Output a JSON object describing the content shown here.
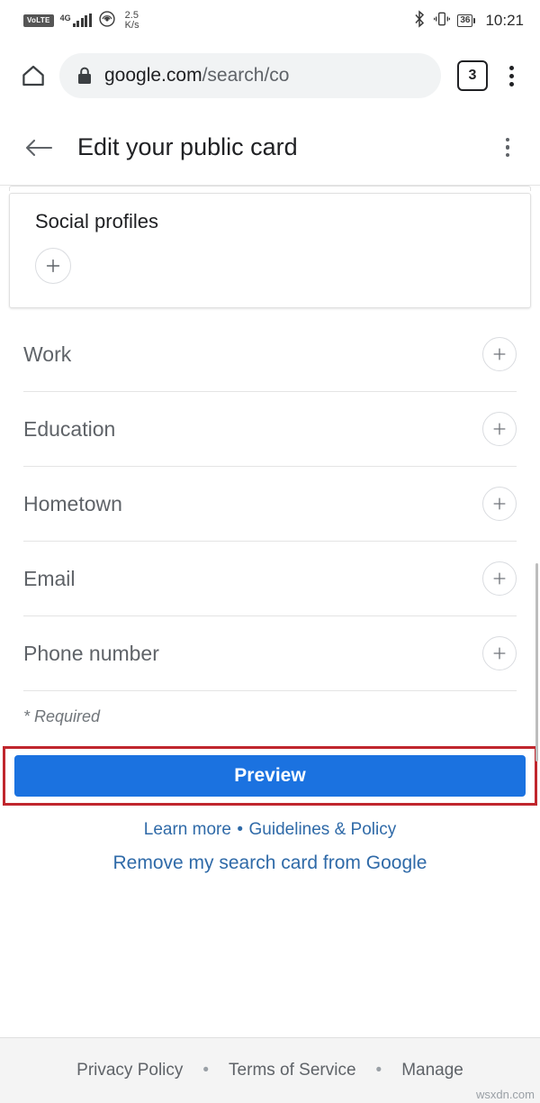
{
  "statusbar": {
    "volte_label": "VoLTE",
    "network_type": "4G",
    "data_rate_value": "2.5",
    "data_rate_unit": "K/s",
    "battery_percent": "36",
    "time": "10:21",
    "icons": [
      "volte-badge",
      "signal-bars-icon",
      "hotspot-icon",
      "bluetooth-icon",
      "vibrate-icon",
      "battery-icon"
    ]
  },
  "browser": {
    "home_icon": "home-icon",
    "lock_icon": "lock-icon",
    "url_main": "google.com/search/co",
    "url_prefix": "google.com",
    "url_path": "/search/co",
    "tab_count": "3",
    "menu_icon": "kebab-menu-icon"
  },
  "header": {
    "back_icon": "back-arrow-icon",
    "title": "Edit your public card",
    "menu_icon": "kebab-menu-icon"
  },
  "social_card": {
    "title": "Social profiles",
    "add_icon": "plus-icon"
  },
  "fields": [
    {
      "label": "Work",
      "add_icon": "plus-icon"
    },
    {
      "label": "Education",
      "add_icon": "plus-icon"
    },
    {
      "label": "Hometown",
      "add_icon": "plus-icon"
    },
    {
      "label": "Email",
      "add_icon": "plus-icon"
    },
    {
      "label": "Phone number",
      "add_icon": "plus-icon"
    }
  ],
  "required_note": "* Required",
  "actions": {
    "preview_label": "Preview",
    "preview_color": "#1b72e0",
    "highlight_color": "#c0262d"
  },
  "links": {
    "learn_more": "Learn more",
    "separator": "•",
    "guidelines": "Guidelines & Policy",
    "remove_card": "Remove my search card from Google",
    "color": "#2f6aa8"
  },
  "footer": {
    "privacy": "Privacy Policy",
    "separator": "•",
    "terms": "Terms of Service",
    "manage": "Manage"
  },
  "watermark": "wsxdn.com"
}
